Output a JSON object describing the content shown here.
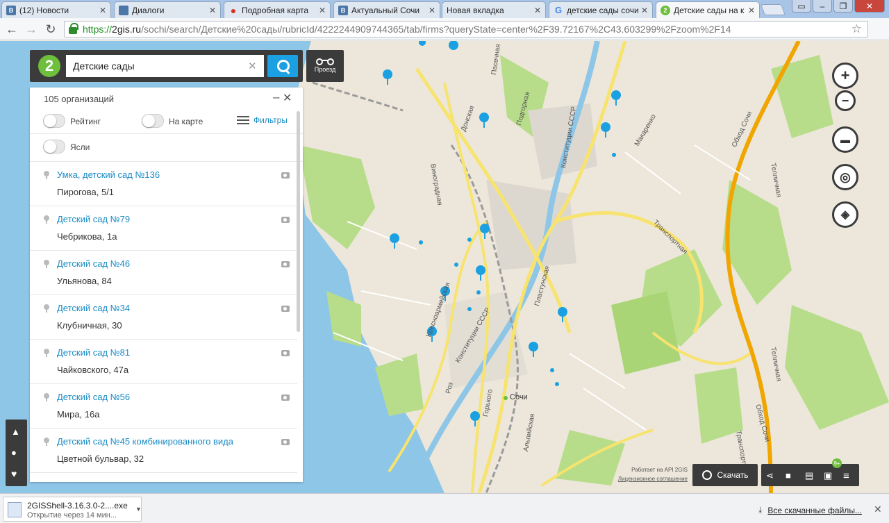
{
  "browser": {
    "tabs": [
      {
        "label": "(12) Новости",
        "favicon": "vk-icon",
        "favicon_color": "#4a76a8",
        "favicon_text": "В"
      },
      {
        "label": "Диалоги",
        "favicon": "vk-icon",
        "favicon_color": "#4a76a8",
        "favicon_text": ""
      },
      {
        "label": "Подробная карта",
        "favicon": "map-pin-icon",
        "favicon_color": "#d93025",
        "favicon_text": ""
      },
      {
        "label": "Актуальный Сочи",
        "favicon": "vk-icon",
        "favicon_color": "#4a76a8",
        "favicon_text": "В"
      },
      {
        "label": "Новая вкладка",
        "favicon": "",
        "favicon_color": "",
        "favicon_text": ""
      },
      {
        "label": "детские сады сочи",
        "favicon": "google-icon",
        "favicon_color": "#4285f4",
        "favicon_text": "G"
      },
      {
        "label": "Детские сады на к",
        "favicon": "2gis-icon",
        "favicon_color": "#6dbf3c",
        "favicon_text": "2"
      }
    ],
    "url_scheme": "https://",
    "url_host": "2gis.ru",
    "url_path": "/sochi/search/Детские%20сады/rubricId/4222244909744365/tab/firms?queryState=center%2F39.72167%2C43.603299%2Fzoom%2F14"
  },
  "search": {
    "query": "Детские сады",
    "route_label": "Проезд"
  },
  "panel": {
    "org_count": "105 организаций",
    "toggles": [
      "Рейтинг",
      "На карте",
      "Ясли"
    ],
    "filters_label": "Фильтры",
    "items": [
      {
        "name": "Умка, детский сад №136",
        "address": "Пирогова, 5/1"
      },
      {
        "name": "Детский сад №79",
        "address": "Чебрикова, 1а"
      },
      {
        "name": "Детский сад №46",
        "address": "Ульянова, 84"
      },
      {
        "name": "Детский сад №34",
        "address": "Клубничная, 30"
      },
      {
        "name": "Детский сад №81",
        "address": "Чайковского, 47а"
      },
      {
        "name": "Детский сад №56",
        "address": "Мира, 16а"
      },
      {
        "name": "Детский сад №45 комбинированного вида",
        "address": "Цветной бульвар, 32"
      }
    ]
  },
  "map": {
    "street_labels": [
      "Пасечная",
      "Донская",
      "Подгорная",
      "Конституции СССР",
      "Макаренко",
      "Обход Сочи",
      "Тепличная",
      "Виноградная",
      "Транспортная",
      "Пластунская",
      "Красноармейская",
      "Конституции СССР",
      "Горького",
      "Роз",
      "Сочи",
      "Пластунская",
      "Транспортная",
      "Тепличная",
      "Обход Сочи",
      "Альпийская"
    ],
    "api_text": "Работает на API 2GIS",
    "license_text": "Лицензионное соглашение",
    "download_label": "Скачать",
    "badge": "9+",
    "colors": {
      "water": "#8ec6e8",
      "green": "#b8dd8a",
      "road": "#f7e36e",
      "highway": "#f0a500",
      "marker": "#1ba0e2",
      "dark": "#3b3b3b"
    }
  },
  "downloads": {
    "file_name": "2GISShell-3.16.3.0-2....exe",
    "file_status": "Открытие через 14 мин...",
    "all_files": "Все скачанные файлы..."
  }
}
